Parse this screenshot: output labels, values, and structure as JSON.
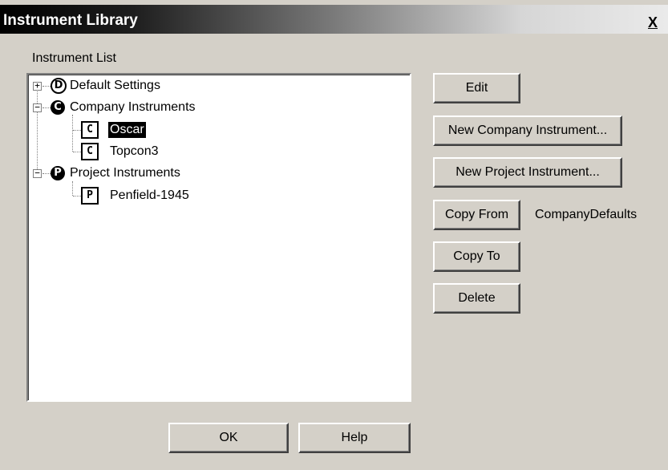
{
  "window": {
    "title": "Instrument Library",
    "close_label": "X"
  },
  "instrument_list": {
    "label": "Instrument List",
    "nodes": [
      {
        "label": "Default Settings",
        "icon_letter": "D",
        "expander": "+"
      },
      {
        "label": "Company Instruments",
        "icon_letter": "C",
        "expander": "−"
      },
      {
        "label": "Oscar",
        "icon_letter": "C",
        "selected": true
      },
      {
        "label": "Topcon3",
        "icon_letter": "C"
      },
      {
        "label": "Project Instruments",
        "icon_letter": "P",
        "expander": "−"
      },
      {
        "label": "Penfield-1945",
        "icon_letter": "P"
      }
    ]
  },
  "actions": {
    "edit": "Edit",
    "new_company": "New Company Instrument...",
    "new_project": "New Project Instrument...",
    "copy_from": "Copy From",
    "copy_from_value": "CompanyDefaults",
    "copy_to": "Copy To",
    "delete": "Delete"
  },
  "footer": {
    "ok": "OK",
    "help": "Help"
  }
}
